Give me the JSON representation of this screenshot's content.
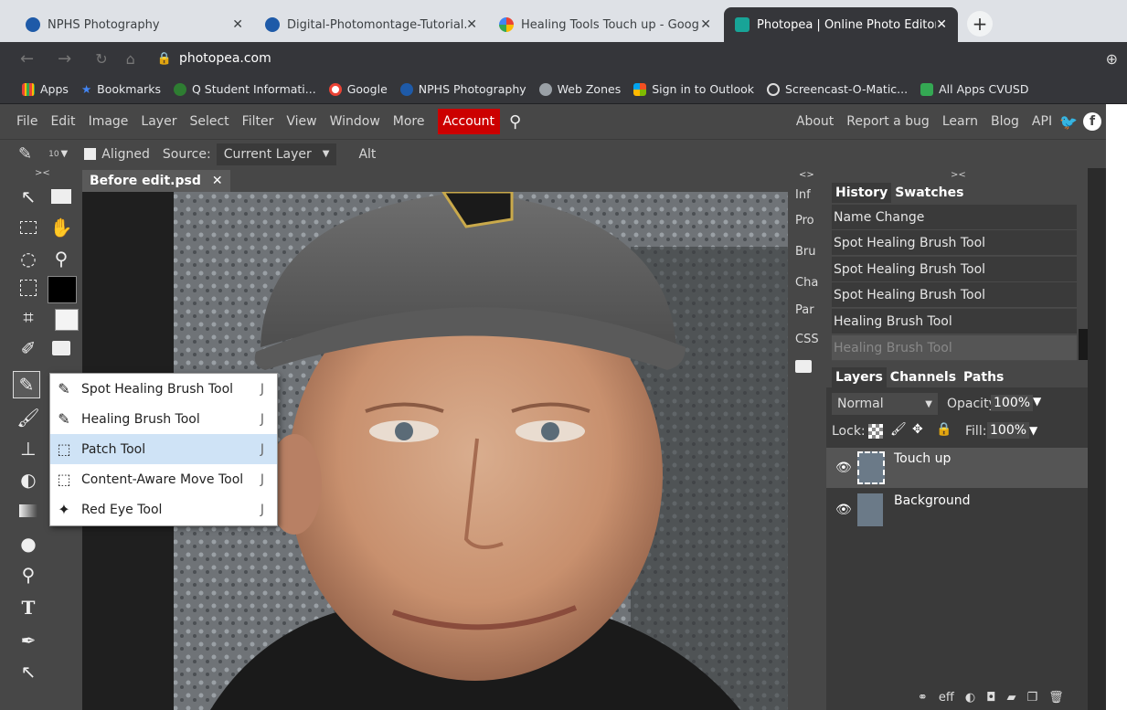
{
  "browser": {
    "tabs": [
      {
        "title": "NPHS Photography",
        "active": false
      },
      {
        "title": "Digital-Photomontage-Tutorial.p",
        "active": false
      },
      {
        "title": "Healing Tools Touch up - Google",
        "active": false
      },
      {
        "title": "Photopea | Online Photo Editor",
        "active": true
      }
    ],
    "close_glyph": "✕",
    "new_tab_glyph": "+",
    "url": "photopea.com",
    "bookmarks": [
      {
        "label": "Apps",
        "color": "#ea4335"
      },
      {
        "label": "Bookmarks",
        "color": "#4285f4"
      },
      {
        "label": "Q Student Informati...",
        "color": "#2e7d32"
      },
      {
        "label": "Google",
        "color": "#4285f4"
      },
      {
        "label": "NPHS Photography",
        "color": "#1e5aa8"
      },
      {
        "label": "Web Zones",
        "color": "#9aa0a6"
      },
      {
        "label": "Sign in to Outlook",
        "color": "#f25022"
      },
      {
        "label": "Screencast-O-Matic...",
        "color": "#1a73e8"
      },
      {
        "label": "All Apps CVUSD",
        "color": "#34a853"
      }
    ]
  },
  "menu": {
    "items": [
      "File",
      "Edit",
      "Image",
      "Layer",
      "Select",
      "Filter",
      "View",
      "Window",
      "More",
      "Account"
    ],
    "right": [
      "About",
      "Report a bug",
      "Learn",
      "Blog",
      "API"
    ]
  },
  "options": {
    "brush_size": "10",
    "aligned_label": "Aligned",
    "source_label": "Source:",
    "source_value": "Current Layer",
    "alt_label": "Alt"
  },
  "toolbar": {
    "collapse_glyph": "><",
    "fg_color": "#000000",
    "bg_color": "#f4f4f4"
  },
  "document": {
    "tab_title": "Before edit.psd",
    "close_glyph": "✕"
  },
  "flyout": {
    "items": [
      {
        "label": "Spot Healing Brush Tool",
        "key": "J",
        "selected": false
      },
      {
        "label": "Healing Brush Tool",
        "key": "J",
        "selected": false
      },
      {
        "label": "Patch Tool",
        "key": "J",
        "selected": true
      },
      {
        "label": "Content-Aware Move Tool",
        "key": "J",
        "selected": false
      },
      {
        "label": "Red Eye Tool",
        "key": "J",
        "selected": false
      }
    ]
  },
  "narrow_panel": {
    "collapse_glyph": "<>",
    "items": [
      "Inf",
      "Pro",
      "Bru",
      "Cha",
      "Par",
      "CSS"
    ]
  },
  "history_panel": {
    "collapse_glyph": "><",
    "tabs": [
      "History",
      "Swatches"
    ],
    "items": [
      "Name Change",
      "Spot Healing Brush Tool",
      "Spot Healing Brush Tool",
      "Spot Healing Brush Tool",
      "Healing Brush Tool",
      "Healing Brush Tool"
    ]
  },
  "layers_panel": {
    "tabs": [
      "Layers",
      "Channels",
      "Paths"
    ],
    "blend_mode": "Normal",
    "opacity_label": "Opacity:",
    "opacity_value": "100%",
    "lock_label": "Lock:",
    "fill_label": "Fill:",
    "fill_value": "100%",
    "layers": [
      {
        "name": "Touch up",
        "selected": true
      },
      {
        "name": "Background",
        "selected": false
      }
    ],
    "footer": [
      "link-icon",
      "eff",
      "adjustment-icon",
      "mask-icon",
      "folder-icon",
      "new-layer-icon",
      "trash-icon"
    ],
    "footer_eff": "eff"
  }
}
